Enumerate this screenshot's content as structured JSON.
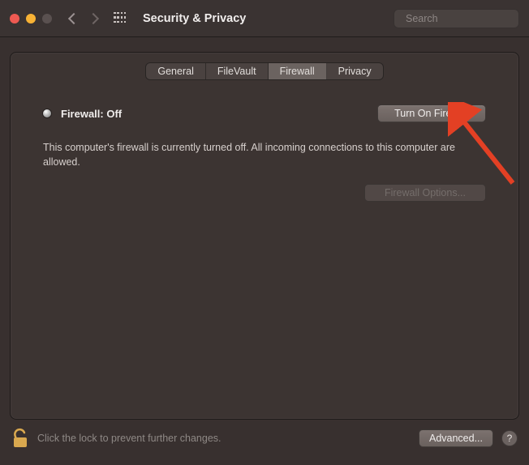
{
  "toolbar": {
    "title": "Security & Privacy",
    "search_placeholder": "Search"
  },
  "tabs": {
    "general": "General",
    "filevault": "FileVault",
    "firewall": "Firewall",
    "privacy": "Privacy"
  },
  "firewall": {
    "status_label": "Firewall: Off",
    "turn_on_label": "Turn On Firewall",
    "options_label": "Firewall Options...",
    "status_description": "This computer's firewall is currently turned off. All incoming connections to this computer are allowed."
  },
  "footer": {
    "lock_text": "Click the lock to prevent further changes.",
    "advanced_label": "Advanced...",
    "help_label": "?"
  },
  "colors": {
    "arrow": "#e34024"
  }
}
